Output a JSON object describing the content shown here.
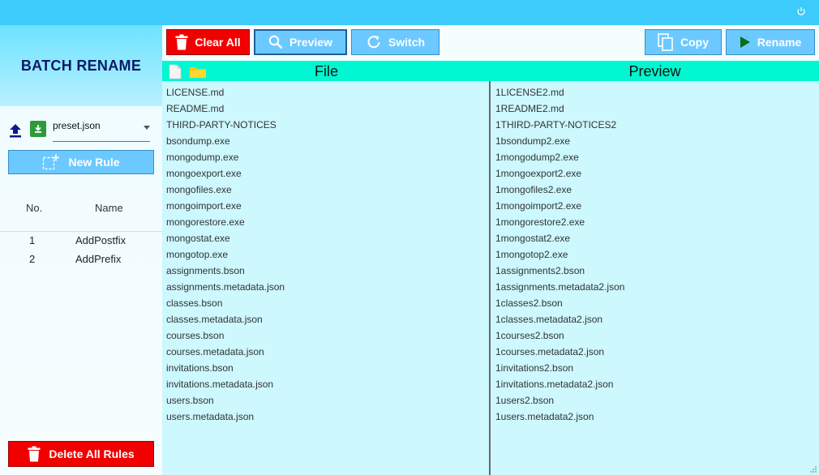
{
  "sidebar": {
    "brand": "BATCH RENAME",
    "preset": {
      "value": "preset.json"
    },
    "new_rule_label": "New Rule",
    "rules_header": {
      "no": "No.",
      "name": "Name"
    },
    "rules": [
      {
        "no": "1",
        "name": "AddPostfix"
      },
      {
        "no": "2",
        "name": "AddPrefix"
      }
    ],
    "delete_label": "Delete All Rules"
  },
  "toolbar": {
    "clear_label": "Clear All",
    "preview_label": "Preview",
    "switch_label": "Switch",
    "copy_label": "Copy",
    "rename_label": "Rename"
  },
  "grid": {
    "file_header": "File",
    "preview_header": "Preview",
    "files": [
      "LICENSE.md",
      "README.md",
      "THIRD-PARTY-NOTICES",
      "bsondump.exe",
      "mongodump.exe",
      "mongoexport.exe",
      "mongofiles.exe",
      "mongoimport.exe",
      "mongorestore.exe",
      "mongostat.exe",
      "mongotop.exe",
      "assignments.bson",
      "assignments.metadata.json",
      "classes.bson",
      "classes.metadata.json",
      "courses.bson",
      "courses.metadata.json",
      "invitations.bson",
      "invitations.metadata.json",
      "users.bson",
      "users.metadata.json"
    ],
    "previews": [
      "1LICENSE2.md",
      "1README2.md",
      "1THIRD-PARTY-NOTICES2",
      "1bsondump2.exe",
      "1mongodump2.exe",
      "1mongoexport2.exe",
      "1mongofiles2.exe",
      "1mongoimport2.exe",
      "1mongorestore2.exe",
      "1mongostat2.exe",
      "1mongotop2.exe",
      "1assignments2.bson",
      "1assignments.metadata2.json",
      "1classes2.bson",
      "1classes.metadata2.json",
      "1courses2.bson",
      "1courses.metadata2.json",
      "1invitations2.bson",
      "1invitations.metadata2.json",
      "1users2.bson",
      "1users.metadata2.json"
    ]
  },
  "icons": {
    "power": "power-icon",
    "upload": "upload-icon",
    "save": "save-icon",
    "add_rule": "add-rule-icon",
    "trash": "trash-icon",
    "search": "search-icon",
    "refresh": "refresh-icon",
    "copy": "copy-icon",
    "play": "play-icon",
    "file": "file-icon",
    "folder": "folder-icon"
  },
  "colors": {
    "titlebar": "#3ccbfb",
    "danger": "#f20000",
    "primary": "#6cc9ff",
    "grid_header": "#00f7d1",
    "grid_bg": "#ccf8fe"
  }
}
